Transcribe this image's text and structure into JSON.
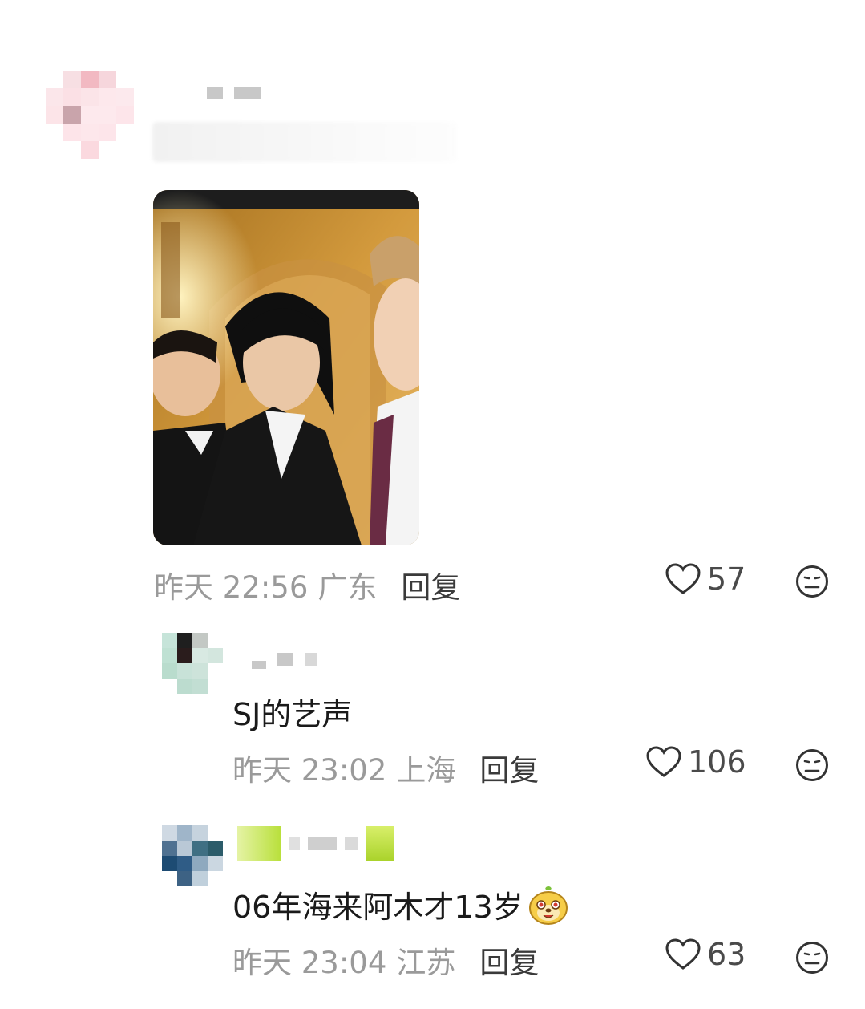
{
  "comments": [
    {
      "time": "昨天 22:56",
      "location": "广东",
      "reply_label": "回复",
      "likes": "57"
    },
    {
      "text": "SJ的艺声",
      "time": "昨天 23:02",
      "location": "上海",
      "reply_label": "回复",
      "likes": "106"
    },
    {
      "text": "06年海来阿木才13岁",
      "time": "昨天 23:04",
      "location": "江苏",
      "reply_label": "回复",
      "likes": "63"
    }
  ],
  "icons": {
    "like": "heart-outline-icon",
    "dislike": "neutral-face-icon",
    "sticker": "sticker-emoji-icon"
  },
  "colors": {
    "meta_gray": "#9a9a9a",
    "reply": "#3a3a3a",
    "text": "#1a1a1a"
  }
}
